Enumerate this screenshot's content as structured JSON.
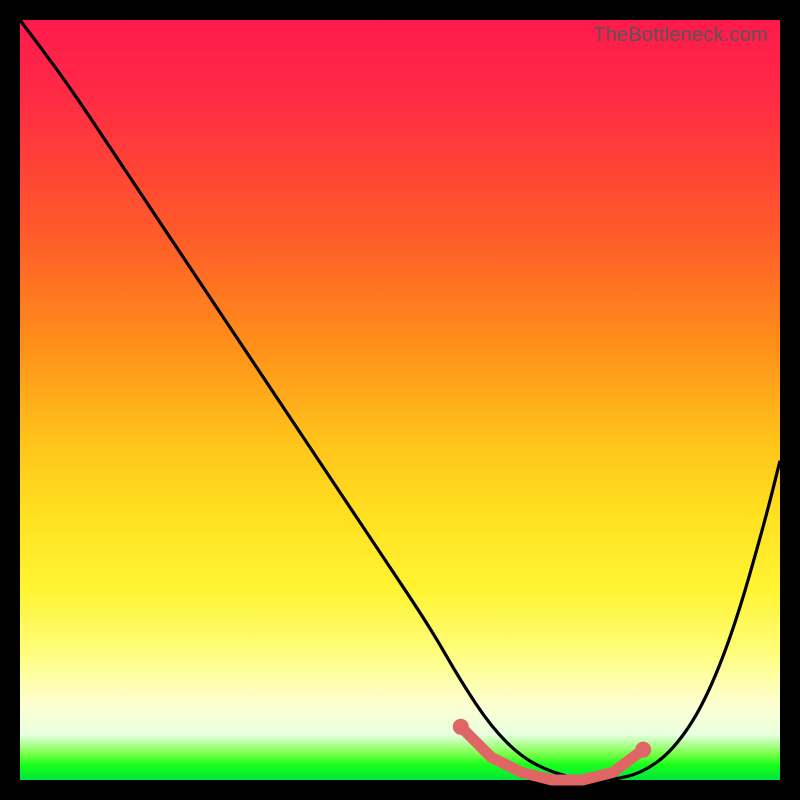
{
  "watermark": "TheBottleneck.com",
  "colors": {
    "background": "#000000",
    "curve": "#000000",
    "marker": "#e06666",
    "gradient_top": "#ff1a4d",
    "gradient_bottom": "#00e63d"
  },
  "chart_data": {
    "type": "line",
    "title": "",
    "xlabel": "",
    "ylabel": "",
    "xlim": [
      0,
      100
    ],
    "ylim": [
      0,
      100
    ],
    "grid": false,
    "legend": false,
    "series": [
      {
        "name": "bottleneck-curve",
        "x": [
          0,
          6,
          12,
          18,
          24,
          30,
          36,
          42,
          48,
          54,
          58,
          62,
          66,
          70,
          74,
          78,
          82,
          86,
          90,
          94,
          98,
          100
        ],
        "y": [
          100,
          92,
          83,
          74,
          65,
          56,
          47,
          38,
          29,
          20,
          13,
          7,
          3,
          1,
          0,
          0,
          1,
          4,
          10,
          20,
          34,
          42
        ]
      }
    ],
    "markers": {
      "name": "highlight-band",
      "x": [
        58,
        62,
        66,
        70,
        74,
        78,
        82
      ],
      "y": [
        7,
        3,
        1,
        0,
        0,
        1,
        4
      ]
    }
  }
}
